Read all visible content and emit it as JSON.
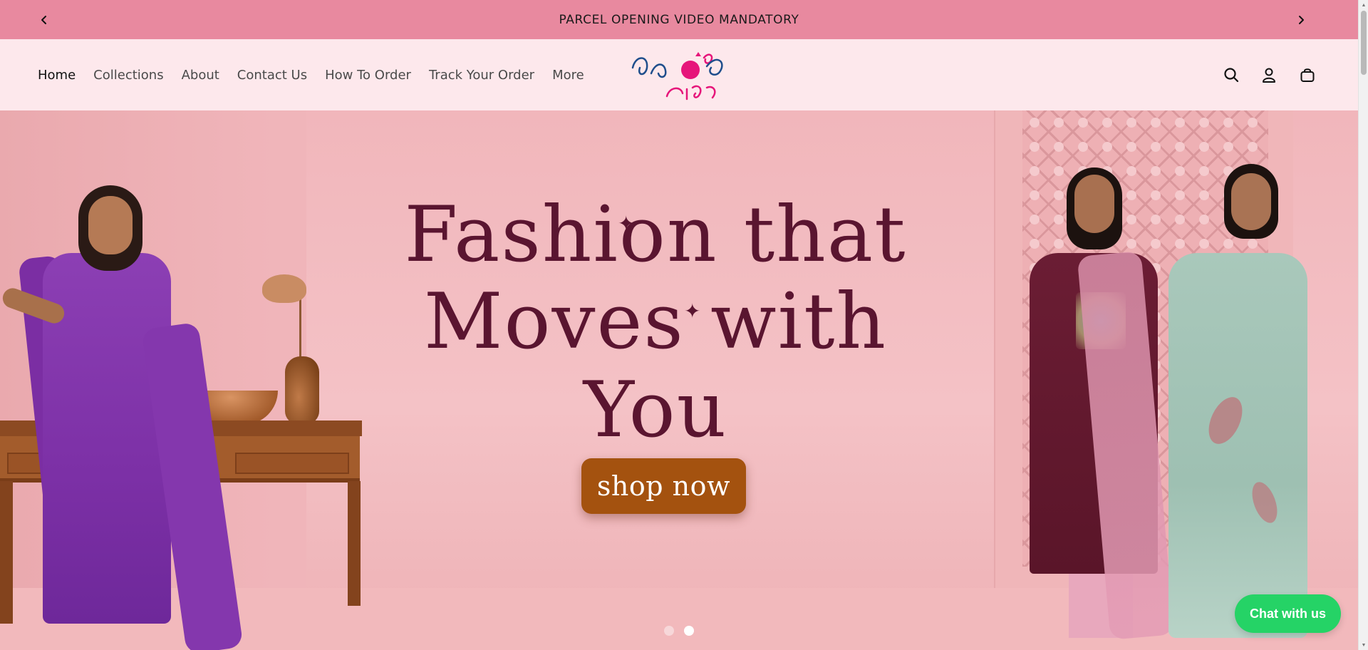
{
  "announcement": {
    "text": "PARCEL OPENING VIDEO MANDATORY",
    "prev_icon": "chevron-left-icon",
    "next_icon": "chevron-right-icon"
  },
  "nav": {
    "items": [
      {
        "label": "Home",
        "active": true
      },
      {
        "label": "Collections"
      },
      {
        "label": "About"
      },
      {
        "label": "Contact Us"
      },
      {
        "label": "How To Order"
      },
      {
        "label": "Track Your Order"
      },
      {
        "label": "More"
      }
    ]
  },
  "logo": {
    "text_top": "వసంత",
    "text_bottom": "గ్రాండ్",
    "accent": "#e6157a",
    "primary": "#1f4e8c"
  },
  "header_icons": [
    "search-icon",
    "account-icon",
    "cart-bag-icon"
  ],
  "hero": {
    "headline_line1": "Fashion that",
    "headline_line2": "Moves with You",
    "cta": "shop now",
    "slides": 2,
    "active_slide": 2
  },
  "chat": {
    "label": "Chat with us"
  },
  "colors": {
    "announcement_bg": "#e8899f",
    "header_bg": "#fde8ec",
    "headline": "#5a1530",
    "cta_bg": "#a4520f",
    "chat_bg": "#25d366"
  }
}
